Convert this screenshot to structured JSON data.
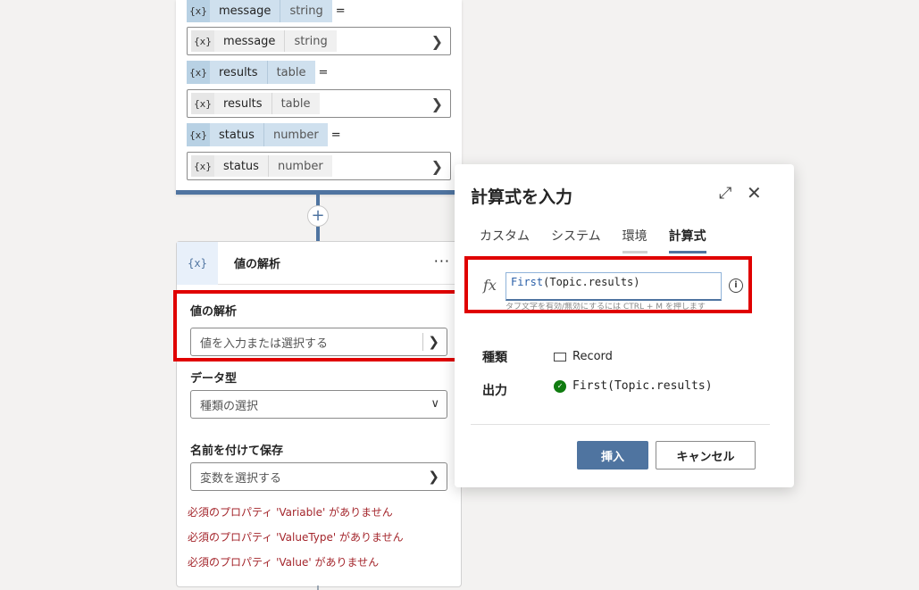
{
  "top_card": {
    "rows": [
      {
        "icon": "{x}",
        "name": "message",
        "type": "string",
        "eq": "=",
        "box_name": "message",
        "box_type": "string"
      },
      {
        "icon": "{x}",
        "name": "results",
        "type": "table",
        "eq": "=",
        "box_name": "results",
        "box_type": "table"
      },
      {
        "icon": "{x}",
        "name": "status",
        "type": "number",
        "eq": "=",
        "box_name": "status",
        "box_type": "number"
      }
    ]
  },
  "add_button": "+",
  "parse_card": {
    "icon": "{x}",
    "title": "値の解析",
    "more": "···",
    "value_label": "値の解析",
    "value_placeholder": "値を入力または選択する",
    "datatype_label": "データ型",
    "datatype_placeholder": "種類の選択",
    "save_label": "名前を付けて保存",
    "save_placeholder": "変数を選択する",
    "errors": [
      "必須のプロパティ 'Variable' がありません",
      "必須のプロパティ 'ValueType' がありません",
      "必須のプロパティ 'Value' がありません"
    ]
  },
  "dialog": {
    "title": "計算式を入力",
    "tabs": [
      "カスタム",
      "システム",
      "環境",
      "計算式"
    ],
    "active_tab": "計算式",
    "fx": "fx",
    "formula_fn": "First",
    "formula_rest": "(Topic.results)",
    "hint": "タブ文字を有効/無効にするには CTRL + M を押します",
    "type_label": "種類",
    "type_value": "Record",
    "output_label": "出力",
    "output_value": "First(Topic.results)",
    "insert_button": "挿入",
    "cancel_button": "キャンセル"
  }
}
